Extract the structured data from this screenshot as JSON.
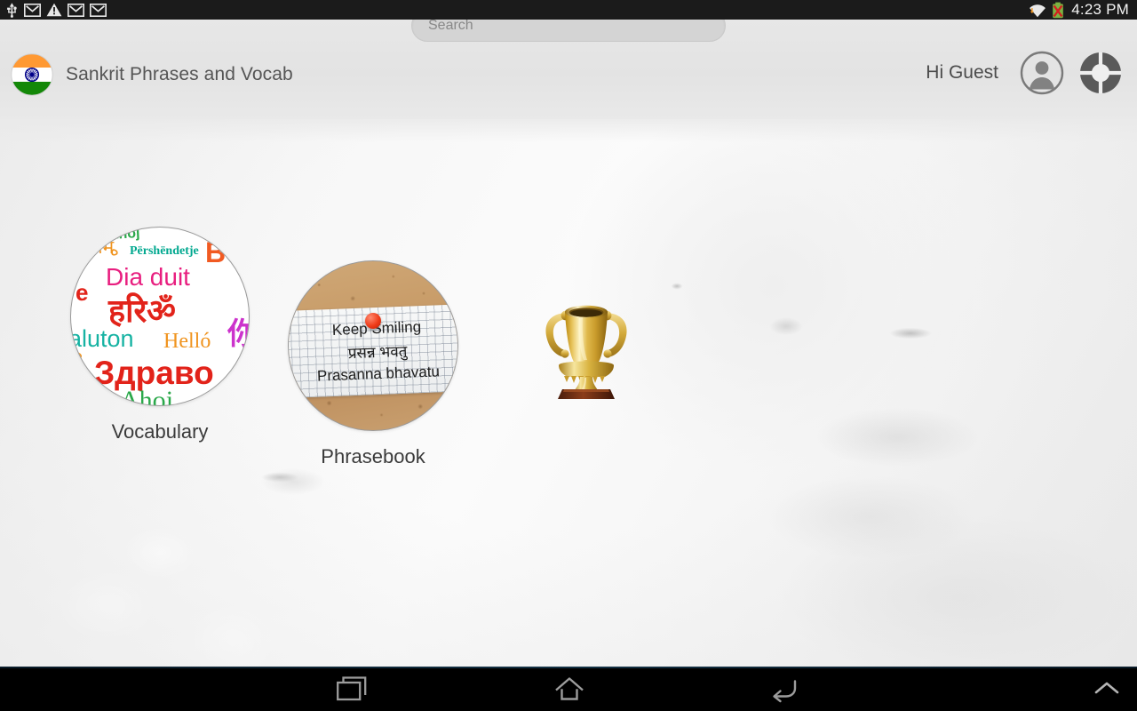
{
  "statusbar": {
    "left_icons": [
      {
        "name": "usb-icon",
        "label": "USB"
      },
      {
        "name": "gmail-icon",
        "label": "Mail"
      },
      {
        "name": "warning-icon",
        "label": "Warning"
      },
      {
        "name": "gmail-icon-2",
        "label": "Mail"
      },
      {
        "name": "gmail-icon-3",
        "label": "Mail"
      }
    ],
    "right_icons": [
      {
        "name": "wifi-icon",
        "label": "Wi-Fi"
      },
      {
        "name": "battery-error-icon",
        "label": "Battery"
      }
    ],
    "clock": "4:23 PM"
  },
  "header": {
    "app_title": "Sankrit Phrases and Vocab",
    "app_icon": "india-flag-icon",
    "greeting": "Hi Guest",
    "avatar_icon": "user-avatar-icon",
    "settings_icon": "settings-gear-icon"
  },
  "search": {
    "placeholder": "Search",
    "value": ""
  },
  "tiles": [
    {
      "id": "vocabulary",
      "label": "Vocabulary",
      "icon": "word-cloud-icon",
      "words": [
        {
          "text": "Përshëndetje",
          "color": "#00a88f"
        },
        {
          "text": "Dia duit",
          "color": "#e81e7f"
        },
        {
          "text": "हरिॐ",
          "color": "#e2231a"
        },
        {
          "text": "aluton",
          "color": "#17b3a3"
        },
        {
          "text": "Helló",
          "color": "#f0941f"
        },
        {
          "text": "Здраво",
          "color": "#e2231a"
        },
        {
          "text": "Ahoj",
          "color": "#2aa84a"
        },
        {
          "text": "В",
          "color": "#f15a22"
        },
        {
          "text": "नम",
          "color": "#f0941f"
        },
        {
          "text": "ه",
          "color": "#f0941f"
        },
        {
          "text": "你",
          "color": "#cc33cc"
        },
        {
          "text": "е",
          "color": "#e2231a"
        }
      ]
    },
    {
      "id": "phrasebook",
      "label": "Phrasebook",
      "icon": "corkboard-note-icon",
      "note": {
        "line1": "Keep Smiling",
        "line2": "प्रसन्न भवतु",
        "line3": "Prasanna bhavatu",
        "pin": "red-pushpin-icon"
      }
    },
    {
      "id": "achievements",
      "label": "",
      "icon": "gold-trophy-icon"
    }
  ],
  "navbar": {
    "buttons": [
      {
        "name": "recents-button",
        "icon": "recents-icon"
      },
      {
        "name": "home-button",
        "icon": "home-icon"
      },
      {
        "name": "back-button",
        "icon": "back-arrow-icon"
      },
      {
        "name": "expand-button",
        "icon": "chevron-up-icon"
      }
    ]
  },
  "colors": {
    "statusbar_bg": "#1b1b1b",
    "header_bg": "#e4e4e4",
    "navbar_bg": "#000000",
    "search_bg": "#d4d4d4",
    "text_primary": "#3a3a3a",
    "flag_saffron": "#ff9933",
    "flag_green": "#138808",
    "flag_chakra": "#000088"
  }
}
